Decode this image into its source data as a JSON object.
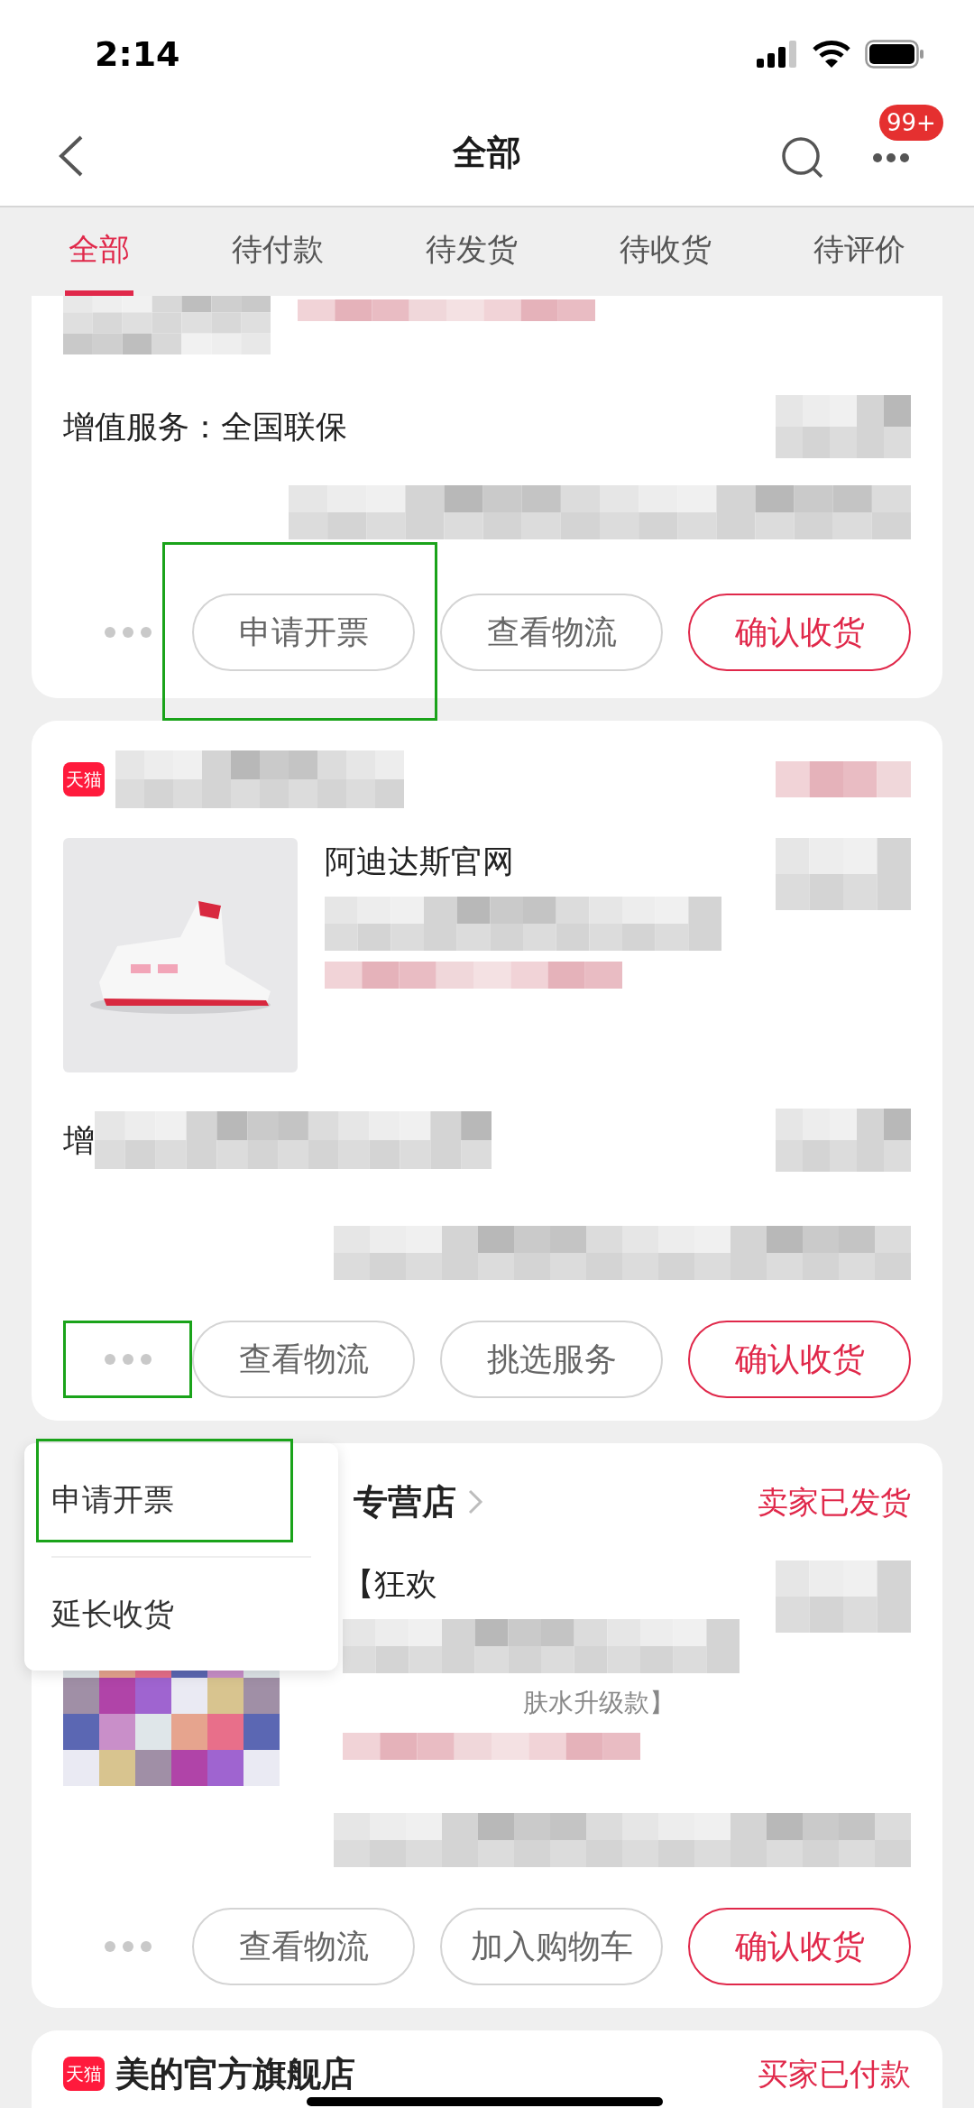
{
  "status_bar": {
    "time": "2:14"
  },
  "nav": {
    "title": "全部",
    "badge": "99+"
  },
  "tabs": [
    {
      "label": "全部",
      "selected": true
    },
    {
      "label": "待付款",
      "selected": false
    },
    {
      "label": "待发货",
      "selected": false
    },
    {
      "label": "待收货",
      "selected": false
    },
    {
      "label": "待评价",
      "selected": false
    }
  ],
  "orders": [
    {
      "kind": "partial",
      "service": "增值服务：全国联保",
      "more_highlighted": false,
      "actions": [
        {
          "label": "申请开票",
          "primary": false,
          "highlighted": true
        },
        {
          "label": "查看物流",
          "primary": false,
          "highlighted": false
        },
        {
          "label": "确认收货",
          "primary": true,
          "highlighted": false
        }
      ]
    },
    {
      "kind": "full",
      "platform_badge": "天猫",
      "product_title": "阿迪达斯官网",
      "service": "增",
      "more_highlighted": true,
      "actions": [
        {
          "label": "查看物流",
          "primary": false,
          "highlighted": false
        },
        {
          "label": "挑选服务",
          "primary": false,
          "highlighted": false
        },
        {
          "label": "确认收货",
          "primary": true,
          "highlighted": false
        }
      ]
    },
    {
      "kind": "full",
      "shop": "专营店",
      "status": "卖家已发货",
      "product_title": "【狂欢",
      "product_note": "肤水升级款】",
      "more_highlighted": false,
      "actions": [
        {
          "label": "查看物流",
          "primary": false,
          "highlighted": false
        },
        {
          "label": "加入购物车",
          "primary": false,
          "highlighted": false
        },
        {
          "label": "确认收货",
          "primary": true,
          "highlighted": false
        }
      ]
    },
    {
      "kind": "header_only",
      "platform_badge": "天猫",
      "shop": "美的官方旗舰店",
      "status": "买家已付款"
    }
  ],
  "popup_menu": {
    "items": [
      {
        "label": "申请开票",
        "highlighted": true
      },
      {
        "label": "延长收货",
        "highlighted": false
      }
    ]
  }
}
